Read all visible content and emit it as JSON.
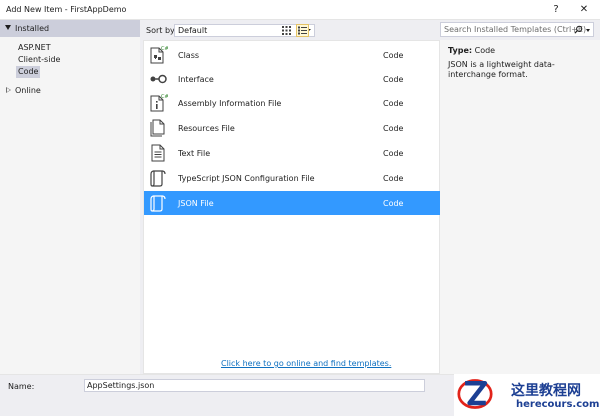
{
  "window": {
    "title": "Add New Item - FirstAppDemo",
    "help_glyph": "?",
    "close_glyph": "✕"
  },
  "sidebar": {
    "installed_label": "Installed",
    "items": [
      {
        "label": "ASP.NET"
      },
      {
        "label": "Client-side"
      },
      {
        "label": "Code"
      }
    ],
    "online_label": "Online"
  },
  "toolbar": {
    "sort_label": "Sort by:",
    "sort_value": "Default"
  },
  "search": {
    "placeholder": "Search Installed Templates (Ctrl+E)"
  },
  "templates": [
    {
      "name": "Class",
      "category": "Code",
      "icon": "class-icon"
    },
    {
      "name": "Interface",
      "category": "Code",
      "icon": "interface-icon"
    },
    {
      "name": "Assembly Information File",
      "category": "Code",
      "icon": "assembly-info-icon"
    },
    {
      "name": "Resources File",
      "category": "Code",
      "icon": "resources-file-icon"
    },
    {
      "name": "Text File",
      "category": "Code",
      "icon": "text-file-icon"
    },
    {
      "name": "TypeScript JSON Configuration File",
      "category": "Code",
      "icon": "json-file-icon"
    },
    {
      "name": "JSON File",
      "category": "Code",
      "icon": "json-file-icon",
      "selected": true
    }
  ],
  "online_link": "Click here to go online and find templates.",
  "details": {
    "type_label": "Type:",
    "type_value": "Code",
    "description": "JSON is a lightweight data-interchange format."
  },
  "name_field": {
    "label": "Name:",
    "value": "AppSettings.json"
  },
  "watermark": {
    "chinese": "这里教程网",
    "url": "herecours.com"
  },
  "colors": {
    "selection": "#3399ff",
    "link": "#0e70c0",
    "watermark": "#1c3f93"
  }
}
